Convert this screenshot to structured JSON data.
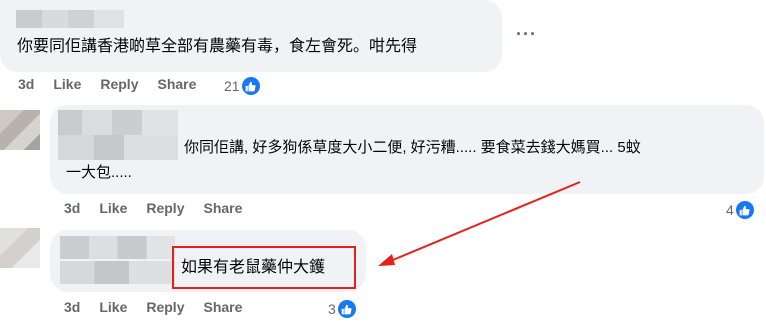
{
  "comments": [
    {
      "text": "你要同佢講香港啲草全部有農藥有毒，食左會死。咁先得",
      "actions": {
        "time": "3d",
        "like": "Like",
        "reply": "Reply",
        "share": "Share"
      },
      "reaction_count": "21",
      "more_icon": "more-dots-icon"
    },
    {
      "text_line1": "你同佢講, 好多狗係草度大小二便, 好污糟..... 要食菜去錢大媽買... 5蚊",
      "text_line2": "一大包.....",
      "actions": {
        "time": "3d",
        "like": "Like",
        "reply": "Reply",
        "share": "Share"
      },
      "reaction_count": "4"
    },
    {
      "text": "如果有老鼠藥仲大鑊",
      "actions": {
        "time": "3d",
        "like": "Like",
        "reply": "Reply",
        "share": "Share"
      },
      "reaction_count": "3"
    }
  ],
  "colors": {
    "bubble": "#f0f2f5",
    "action_text": "#65676b",
    "like_badge": "#1877f2",
    "annotation": "#e3221c"
  },
  "icons": [
    "like-thumb-icon",
    "more-dots-icon",
    "annotation-arrow"
  ]
}
